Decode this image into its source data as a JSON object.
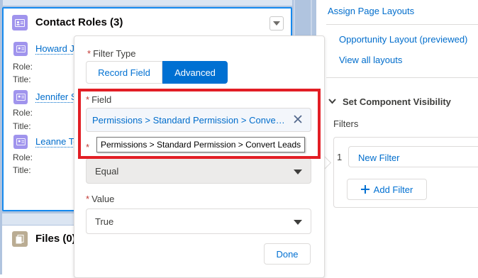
{
  "contact_roles": {
    "title": "Contact Roles (3)",
    "contacts": [
      {
        "name": "Howard J",
        "role_label": "Role:",
        "title_label": "Title:"
      },
      {
        "name": "Jennifer S",
        "role_label": "Role:",
        "title_label": "Title:"
      },
      {
        "name": "Leanne To",
        "role_label": "Role:",
        "title_label": "Title:"
      }
    ]
  },
  "files_card": {
    "title": "Files (0)"
  },
  "popover": {
    "filter_type_label": "Filter Type",
    "filter_type_options": [
      "Record Field",
      "Advanced"
    ],
    "filter_type_selected": "Advanced",
    "field_label": "Field",
    "field_value": "Permissions > Standard Permission > Convert Leads",
    "field_tooltip": "Permissions > Standard Permission > Convert Leads",
    "operator_value": "Equal",
    "value_label": "Value",
    "value_value": "True",
    "done_label": "Done",
    "highlight_color": "#e21e25"
  },
  "right_panel": {
    "assign_page_layouts": "Assign Page Layouts",
    "layout_link": "Opportunity Layout (previewed)",
    "view_all_layouts": "View all layouts",
    "section_title": "Set Component Visibility",
    "filters_label": "Filters",
    "filter_index": "1",
    "new_filter_label": "New Filter",
    "add_filter_label": "Add Filter"
  },
  "colors": {
    "brand_blue": "#0070d2",
    "link_blue": "#006dcc",
    "canvas_bg": "#b0c4df",
    "contact_icon": "#a094ed",
    "files_icon": "#baac93",
    "required": "#c23934"
  }
}
